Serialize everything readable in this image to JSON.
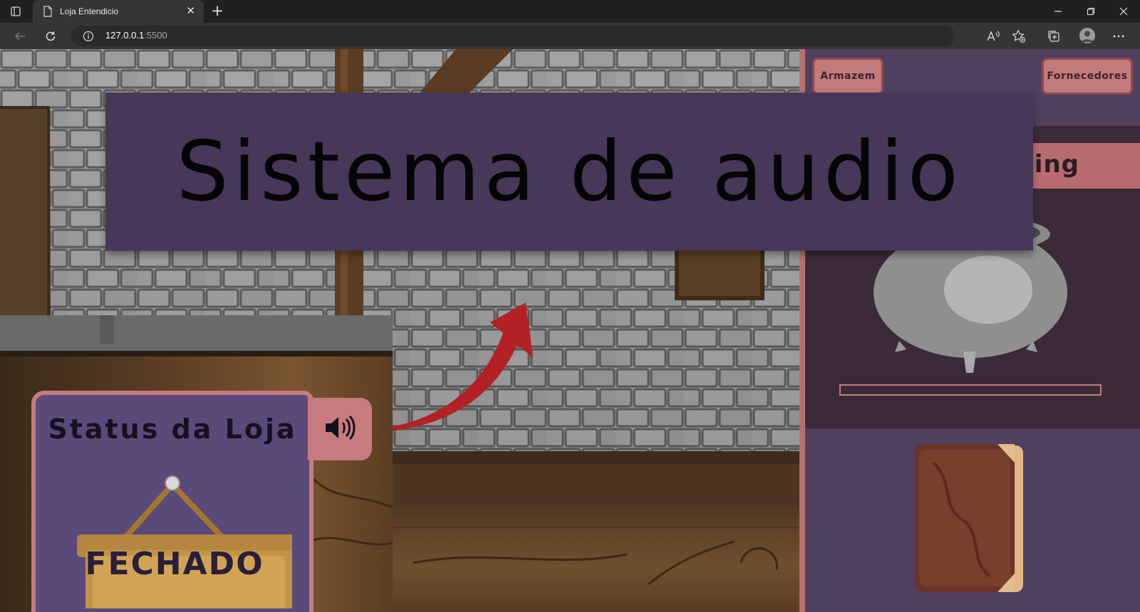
{
  "browser": {
    "tab_title": "Loja Entendicio",
    "tab_close": "✕",
    "new_tab": "+",
    "url_host": "127.0.0.1",
    "url_port": ":5500"
  },
  "sidebar": {
    "armazem_label": "Armazem",
    "fornecedores_label": "Fornecedores",
    "crafting_label": "Crafting",
    "crafting_visible_fragment": "cing",
    "progress_percent": 0
  },
  "overlay": {
    "title": "Sistema de audio"
  },
  "inset": {
    "status_title": "Status da Loja",
    "sign_text": "FECHADO"
  },
  "icons": {
    "sound": "speaker-volume-icon",
    "cauldron": "cauldron-icon",
    "book": "spellbook-icon"
  },
  "colors": {
    "accent_pink": "#c37a7a",
    "panel_purple": "#51405e",
    "banner_purple": "#47385a",
    "arrow_red": "#b32026"
  }
}
